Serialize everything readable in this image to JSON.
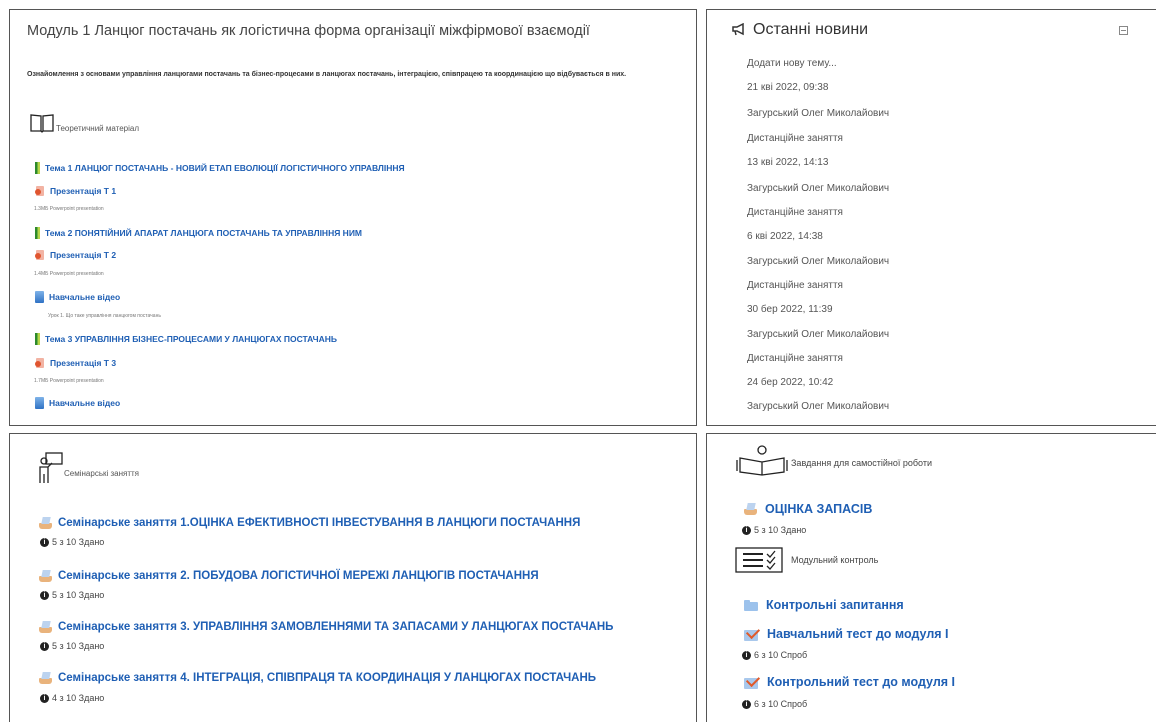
{
  "module": {
    "title": "Модуль 1 Ланцюг постачань як логістична форма організації міжфірмової взаємодії",
    "description": "Ознайомлення з основами управління ланцюгами постачань та бізнес-процесами в ланцюгах постачань, інтеграцією, співпрацею та координацією що відбувається в них.",
    "theory_label": "Теоретичний матеріал",
    "resources": [
      {
        "label": "Тема 1 ЛАНЦЮГ ПОСТАЧАНЬ - НОВИЙ ЕТАП ЕВОЛЮЦІЇ ЛОГІСТИЧНОГО УПРАВЛІННЯ",
        "icon": "book-icon"
      },
      {
        "label": "Презентація Т 1",
        "icon": "powerpoint-icon",
        "sub": "1.3МБ Powerpoint presentation"
      },
      {
        "label": "Тема 2 ПОНЯТІЙНИЙ АПАРАТ ЛАНЦЮГА ПОСТАЧАНЬ ТА УПРАВЛІННЯ НИМ",
        "icon": "book-icon"
      },
      {
        "label": "Презентація Т 2",
        "icon": "powerpoint-icon",
        "sub": "1.4МБ Powerpoint presentation"
      },
      {
        "label": "Навчальне відео",
        "icon": "file-icon",
        "sub": "Урок 1. Що таке управління ланцюгом постачань"
      },
      {
        "label": "Тема 3 УПРАВЛІННЯ БІЗНЕС-ПРОЦЕСАМИ У ЛАНЦЮГАХ ПОСТАЧАНЬ",
        "icon": "book-icon"
      },
      {
        "label": "Презентація Т 3",
        "icon": "powerpoint-icon",
        "sub": "1.7МБ Powerpoint presentation"
      },
      {
        "label": "Навчальне відео",
        "icon": "file-icon"
      }
    ]
  },
  "news": {
    "title": "Останні новини",
    "add_topic": "Додати нову тему...",
    "items": [
      {
        "date": "21 кві 2022, 09:38",
        "author": "Загурський Олег Миколайович",
        "subject": "Дистанційне заняття"
      },
      {
        "date": "13 кві 2022, 14:13",
        "author": "Загурський Олег Миколайович",
        "subject": "Дистанційне заняття"
      },
      {
        "date": "6 кві 2022, 14:38",
        "author": "Загурський Олег Миколайович",
        "subject": "Дистанційне заняття"
      },
      {
        "date": "30 бер 2022, 11:39",
        "author": "Загурський Олег Миколайович",
        "subject": "Дистанційне заняття"
      },
      {
        "date": "24 бер 2022, 10:42",
        "author": "Загурський Олег Миколайович"
      }
    ]
  },
  "seminars": {
    "label": "Семінарські заняття",
    "items": [
      {
        "prefix": "Семінарське заняття ",
        "title": "1.ОЦІНКА ЕФЕКТИВНОСТІ ІНВЕСТУВАННЯ В ЛАНЦЮГИ ПОСТАЧАННЯ",
        "status": "5 з 10 Здано"
      },
      {
        "prefix": "Семінарське заняття ",
        "title": "2. ПОБУДОВА ЛОГІСТИЧНОЇ МЕРЕЖІ ЛАНЦЮГІВ ПОСТАЧАННЯ",
        "status": "5 з 10 Здано"
      },
      {
        "prefix": "Семінарське заняття ",
        "title": "3. УПРАВЛІННЯ ЗАМОВЛЕННЯМИ ТА ЗАПАСАМИ У ЛАНЦЮГАХ ПОСТАЧАНЬ",
        "status": "5 з 10 Здано"
      },
      {
        "prefix": "Семінарське заняття ",
        "title": "4. ІНТЕГРАЦІЯ, СПІВПРАЦЯ ТА КООРДИНАЦІЯ У ЛАНЦЮГАХ ПОСТАЧАНЬ",
        "status": "4 з 10 Здано"
      }
    ]
  },
  "self_work": {
    "label": "Завдання для самостійної роботи",
    "assignment": {
      "title": "ОЦІНКА ЗАПАСІВ",
      "status": "5 з 10 Здано"
    },
    "module_control_label": "Модульний контроль",
    "folder": {
      "title": "Контрольні запитання"
    },
    "quizzes": [
      {
        "title": "Навчальний тест до модуля І",
        "status": "6 з 10 Спроб"
      },
      {
        "title": "Контрольний тест до модуля І",
        "status": "6 з 10 Спроб"
      }
    ]
  }
}
